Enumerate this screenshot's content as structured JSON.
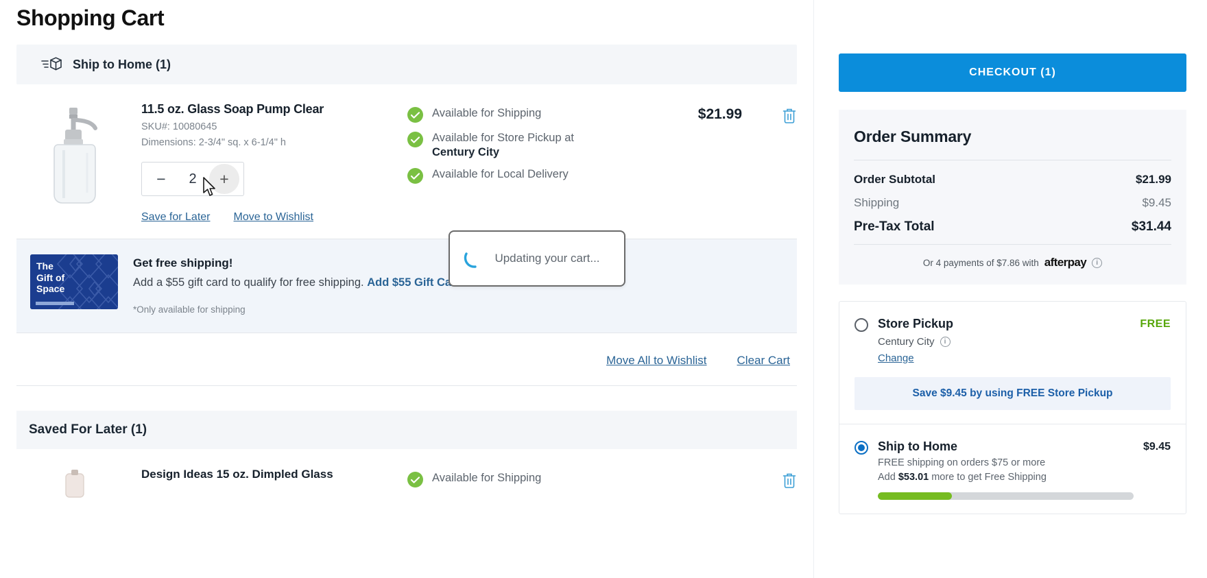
{
  "page": {
    "title": "Shopping Cart"
  },
  "ship_section": {
    "icon": "shipping-box-icon",
    "label": "Ship to Home (1)"
  },
  "cart_item": {
    "image_alt": "glass-soap-pump-product-image",
    "title": "11.5 oz. Glass Soap Pump Clear",
    "sku": "SKU#: 10080645",
    "dimensions": "Dimensions: 2-3/4\" sq. x 6-1/4\" h",
    "quantity": "2",
    "minus_label": "−",
    "plus_label": "+",
    "save_for_later": "Save for Later",
    "move_to_wishlist": "Move to Wishlist",
    "price": "$21.99",
    "availability": [
      {
        "text": "Available for Shipping",
        "strong": ""
      },
      {
        "text": "Available for Store Pickup at",
        "strong": "Century City"
      },
      {
        "text": "Available for Local Delivery",
        "strong": ""
      }
    ],
    "delete_icon": "trash-icon"
  },
  "promo": {
    "card_line1": "The",
    "card_line2": "Gift of",
    "card_line3": "Space",
    "heading": "Get free shipping!",
    "body": "Add a $55 gift card to qualify for free shipping.",
    "link": "Add $55 Gift Card",
    "chevron": "›",
    "note": "*Only available for shipping"
  },
  "bulk_actions": {
    "move_all": "Move All to Wishlist",
    "clear_cart": "Clear Cart"
  },
  "saved": {
    "heading": "Saved For Later (1)",
    "item_title": "Design Ideas 15 oz. Dimpled Glass",
    "availability": "Available for Shipping",
    "delete_icon": "trash-icon"
  },
  "loading": {
    "text": "Updating your cart...",
    "icon": "spinner-icon"
  },
  "sidebar": {
    "checkout_label": "CHECKOUT (1)",
    "summary_title": "Order Summary",
    "rows": [
      {
        "label": "Order Subtotal",
        "value": "$21.99",
        "muted": false,
        "total": false
      },
      {
        "label": "Shipping",
        "value": "$9.45",
        "muted": true,
        "total": false
      },
      {
        "label": "Pre-Tax Total",
        "value": "$31.44",
        "muted": false,
        "total": true
      }
    ],
    "afterpay_text": "Or 4 payments of $7.86 with",
    "afterpay_logo": "afterpay",
    "afterpay_info": "i",
    "store_pickup": {
      "title": "Store Pickup",
      "price": "FREE",
      "store": "Century City",
      "info": "i",
      "change": "Change",
      "save_banner": "Save $9.45 by using FREE Store Pickup",
      "selected": false
    },
    "ship_to_home": {
      "title": "Ship to Home",
      "price": "$9.45",
      "note1": "FREE shipping on orders $75 or more",
      "note2_pre": "Add ",
      "note2_amt": "$53.01",
      "note2_post": " more to get Free Shipping",
      "progress_pct": 29,
      "selected": true
    }
  },
  "colors": {
    "accent_blue": "#0b8ddb",
    "link_blue": "#2a6496",
    "green": "#7ac043",
    "progress_green": "#76bc21",
    "free_green": "#57a60a"
  }
}
